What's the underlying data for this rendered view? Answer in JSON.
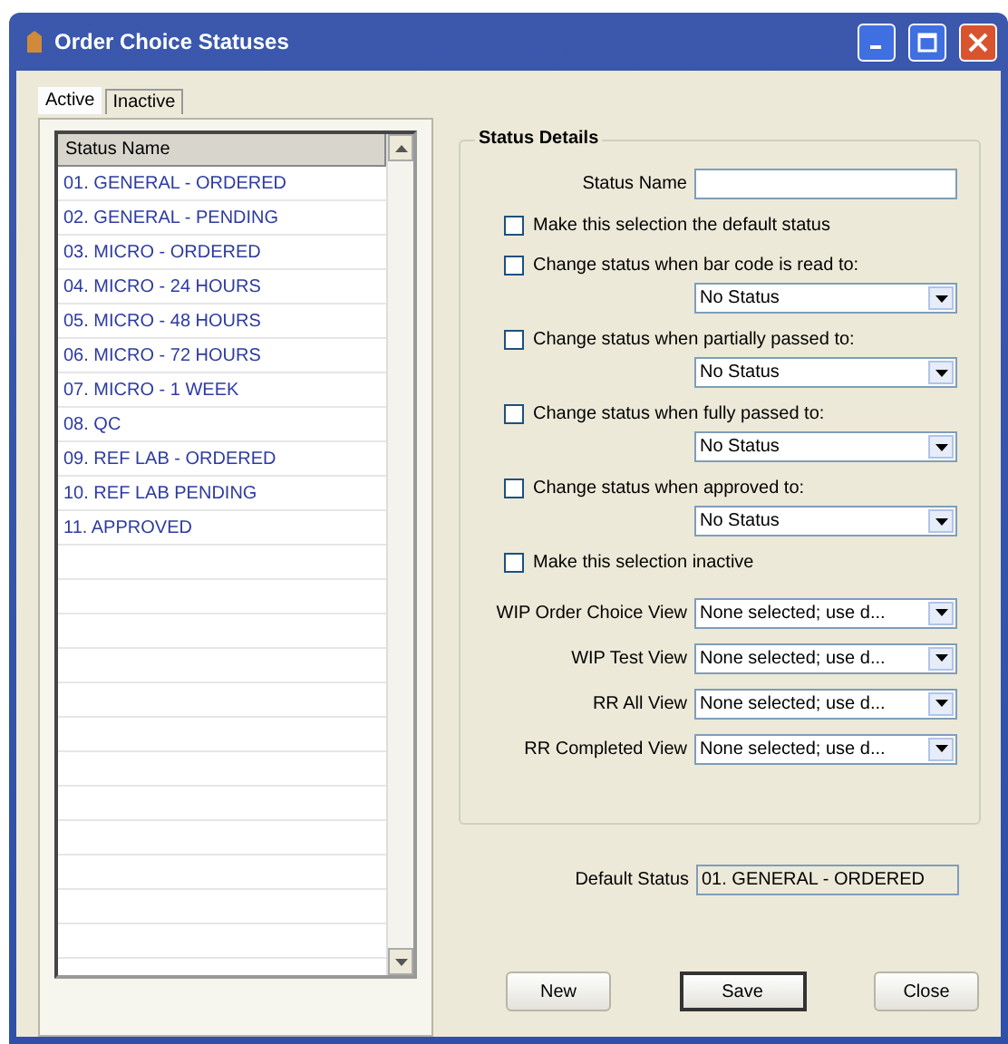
{
  "window": {
    "title": "Order Choice Statuses"
  },
  "tabs": [
    {
      "label": "Active",
      "selected": true
    },
    {
      "label": "Inactive",
      "selected": false
    }
  ],
  "list": {
    "column": "Status Name",
    "rows": [
      {
        "label": "01. GENERAL - ORDERED"
      },
      {
        "label": "02. GENERAL - PENDING"
      },
      {
        "label": "03. MICRO - ORDERED"
      },
      {
        "label": "04. MICRO - 24 HOURS"
      },
      {
        "label": "05. MICRO - 48 HOURS"
      },
      {
        "label": "06. MICRO - 72 HOURS"
      },
      {
        "label": "07. MICRO - 1 WEEK"
      },
      {
        "label": "08. QC"
      },
      {
        "label": "09. REF LAB - ORDERED"
      },
      {
        "label": "10. REF LAB PENDING"
      },
      {
        "label": "11. APPROVED"
      }
    ]
  },
  "details": {
    "title": "Status Details",
    "status_name": {
      "label": "Status Name"
    },
    "options": [
      {
        "kind": "checkbox",
        "label": "Make this selection the default status",
        "checked": false
      },
      {
        "kind": "checkbox_combo",
        "label": "Change status when bar code is read to:",
        "checked": false,
        "value": "No Status"
      },
      {
        "kind": "checkbox_combo",
        "label": "Change status when partially passed to:",
        "checked": false,
        "value": "No Status"
      },
      {
        "kind": "checkbox_combo",
        "label": "Change status when fully passed to:",
        "checked": false,
        "value": "No Status"
      },
      {
        "kind": "checkbox_combo",
        "label": "Change status when approved to:",
        "checked": false,
        "value": "No Status"
      },
      {
        "kind": "checkbox",
        "label": "Make this selection inactive",
        "checked": false
      }
    ],
    "views": [
      {
        "label": "WIP Order Choice View",
        "value": "None selected; use d..."
      },
      {
        "label": "WIP Test View",
        "value": "None selected; use d..."
      },
      {
        "label": "RR All View",
        "value": "None selected; use d..."
      },
      {
        "label": "RR Completed View",
        "value": "None selected; use d..."
      }
    ]
  },
  "default_status": {
    "label": "Default Status",
    "value": "01. GENERAL - ORDERED"
  },
  "buttons": [
    {
      "label": "New",
      "default": false
    },
    {
      "label": "Save",
      "default": true
    },
    {
      "label": "Close",
      "default": false
    }
  ]
}
